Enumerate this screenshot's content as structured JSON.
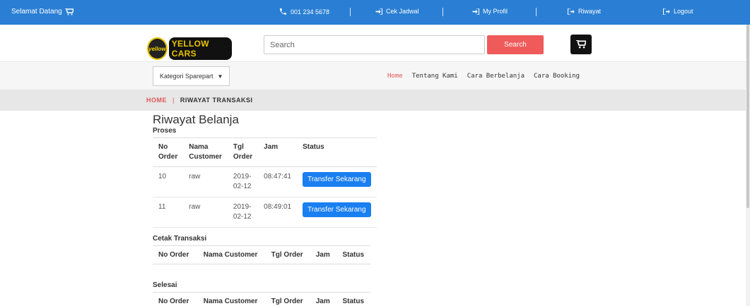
{
  "topbar": {
    "welcome": "Selamat Datang",
    "phone": "001 234 5678",
    "cek_jadwal": "Cek Jadwal",
    "my_profil": "My Profil",
    "riwayat": "Riwayat",
    "logout": "Logout"
  },
  "header": {
    "logo_badge": "yellow",
    "logo_text": "YELLOW CARS",
    "search_placeholder": "Search",
    "search_button": "Search"
  },
  "nav": {
    "kategori": "Kategori Sparepart",
    "links": [
      "Home",
      "Tentang Kami",
      "Cara Berbelanja",
      "Cara Booking"
    ]
  },
  "breadcrumb": {
    "home": "HOME",
    "separator": "|",
    "current": "RIWAYAT TRANSAKSI"
  },
  "main": {
    "title": "Riwayat Belanja",
    "proses": {
      "title": "Proses",
      "headers": [
        "No Order",
        "Nama Customer",
        "Tgl Order",
        "Jam",
        "Status"
      ],
      "rows": [
        {
          "no": "10",
          "nama": "raw",
          "tgl": "2019-02-12",
          "jam": "08:47:41",
          "status": "Transfer Sekarang"
        },
        {
          "no": "11",
          "nama": "raw",
          "tgl": "2019-02-12",
          "jam": "08:49:01",
          "status": "Transfer Sekarang"
        }
      ]
    },
    "cetak": {
      "title": "Cetak Transaksi",
      "headers": [
        "No Order",
        "Nama Customer",
        "Tgl Order",
        "Jam",
        "Status"
      ]
    },
    "selesai": {
      "title": "Selesai",
      "headers": [
        "No Order",
        "Nama Customer",
        "Tgl Order",
        "Jam",
        "Status"
      ]
    }
  },
  "colors": {
    "topbar": "#2a7fd4",
    "accent_red": "#ef5b5b",
    "button_blue": "#1a7ff0"
  }
}
